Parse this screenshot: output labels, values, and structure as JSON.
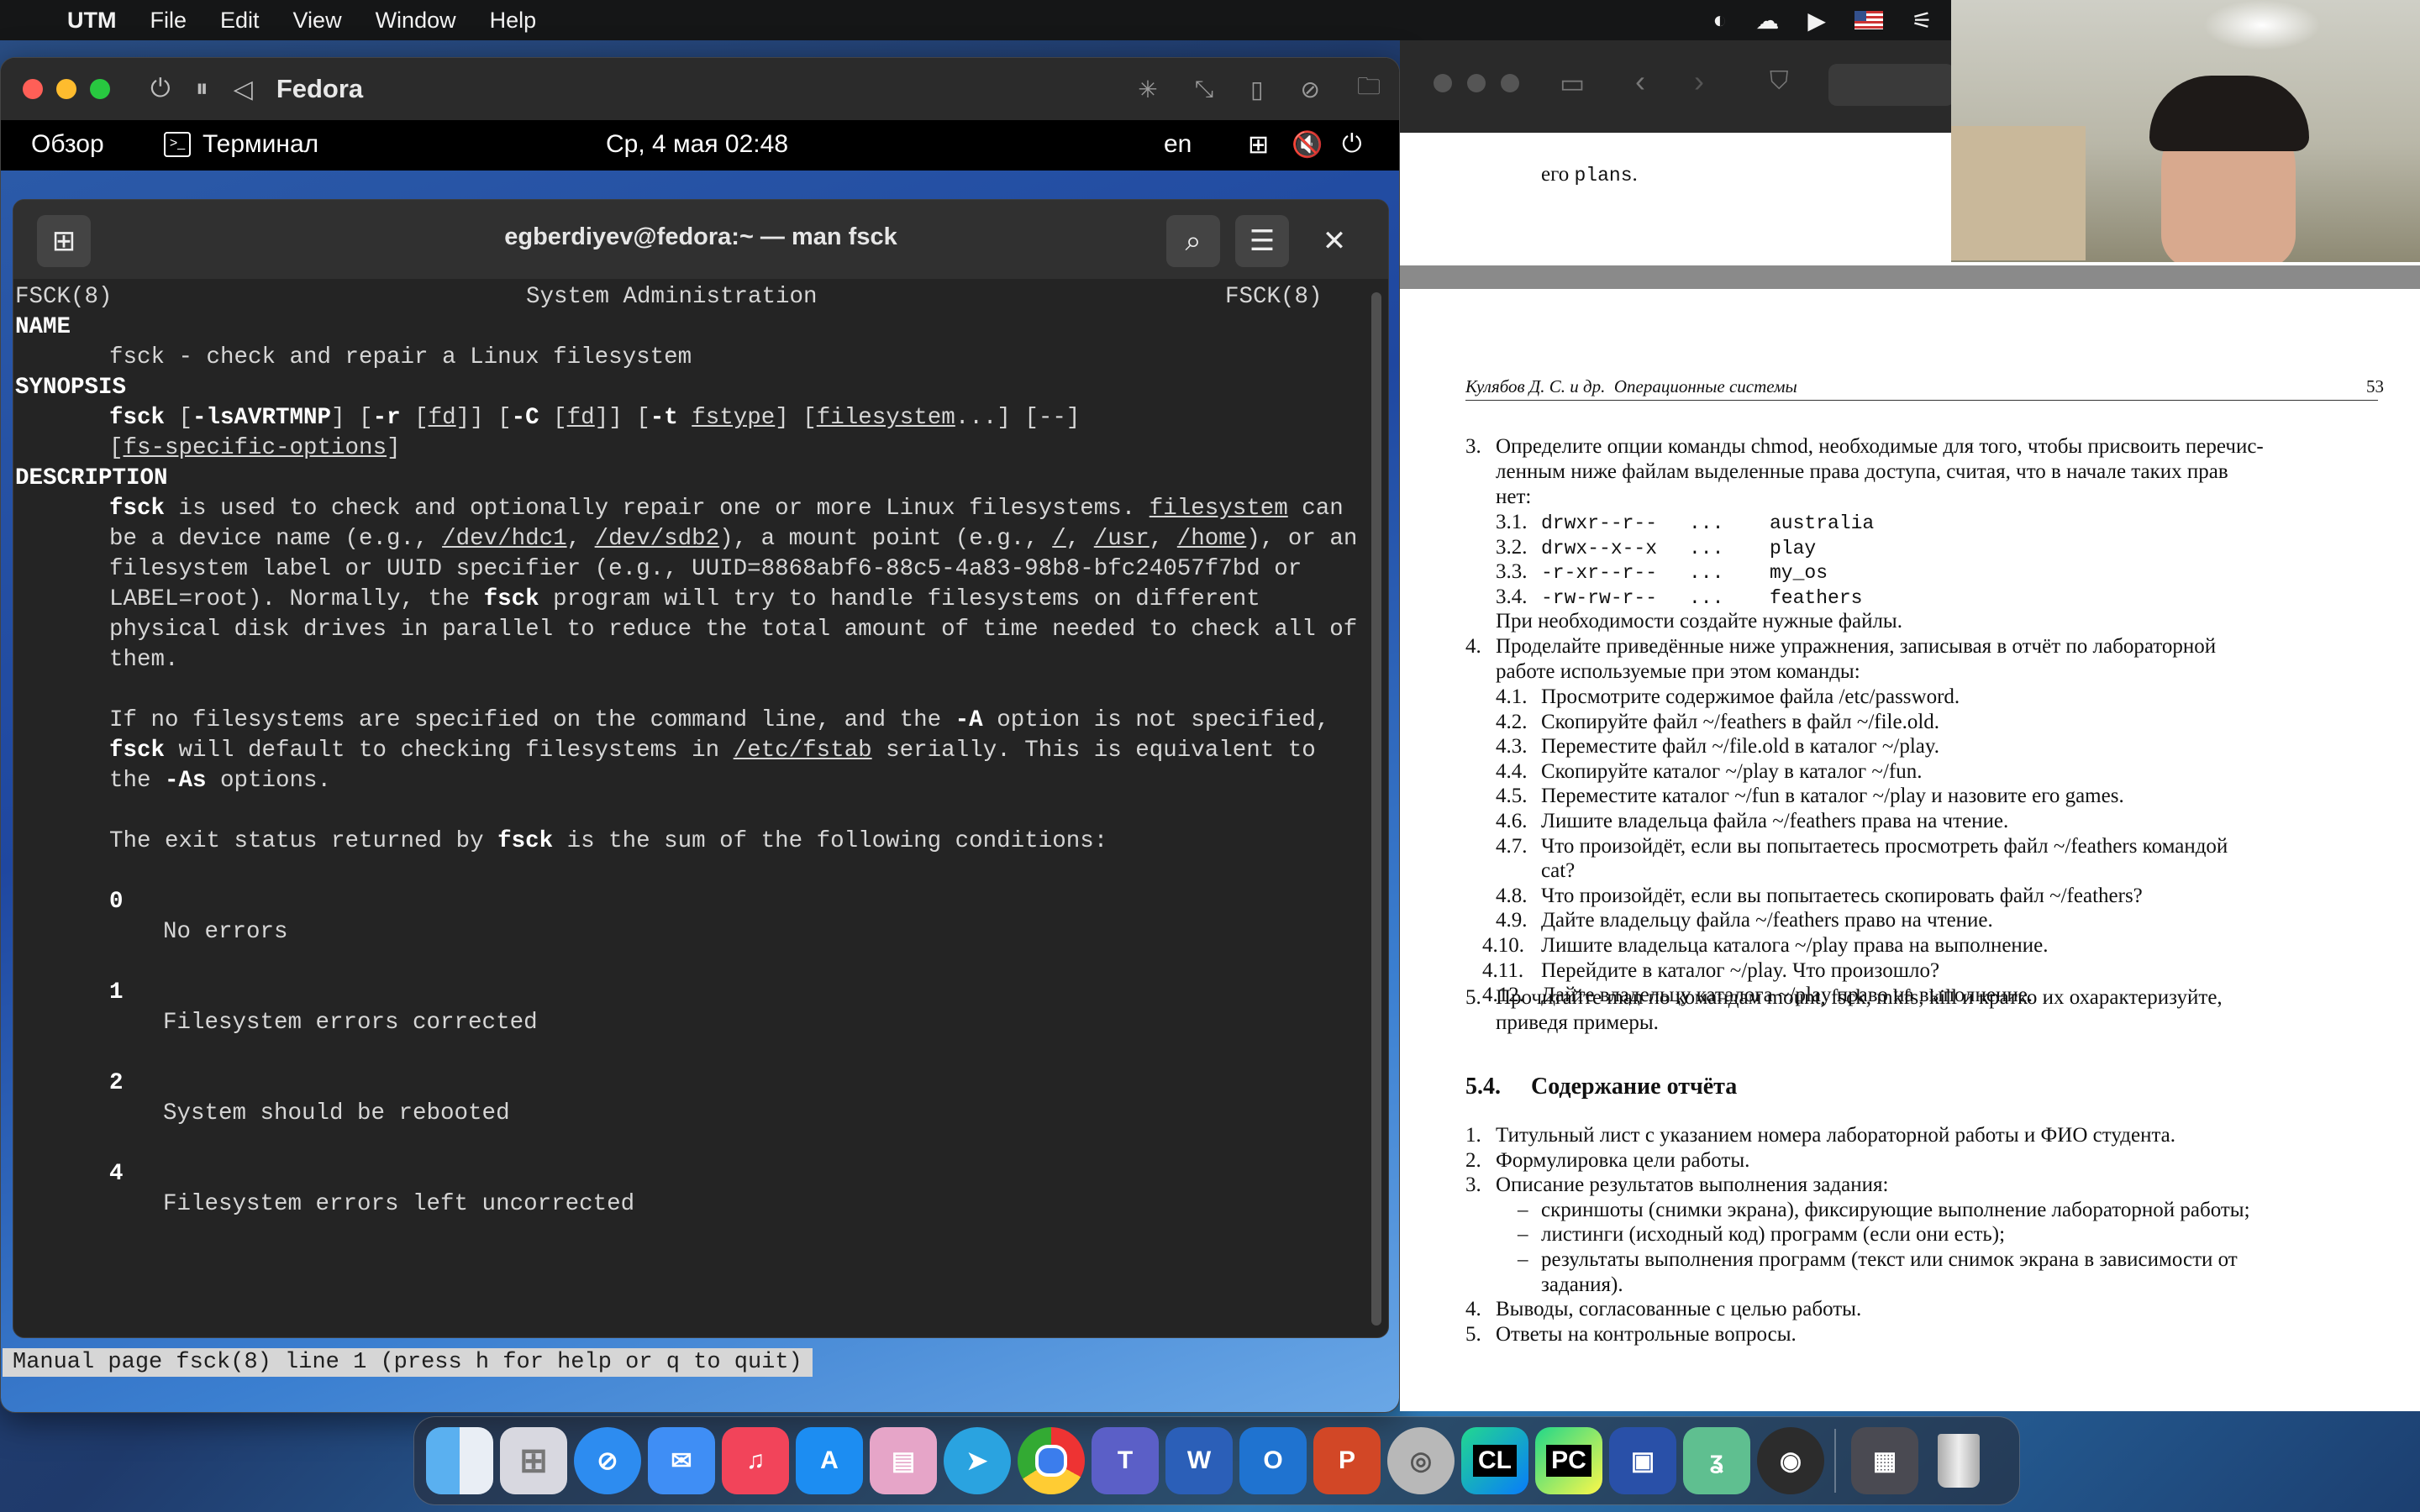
{
  "menubar": {
    "app": "UTM",
    "items": [
      "File",
      "Edit",
      "View",
      "Window",
      "Help"
    ]
  },
  "utm": {
    "vm_name": "Fedora"
  },
  "gnome": {
    "overview": "Обзор",
    "terminal_app": "Терминал",
    "clock": "Ср, 4 мая  02:48",
    "lang": "en"
  },
  "terminal": {
    "title": "egberdiyev@fedora:~ — man fsck",
    "status": "Manual page fsck(8) line 1 (press h for help or q to quit)",
    "header_left": "FSCK(8)",
    "header_center": "System Administration",
    "header_right": "FSCK(8)",
    "name_heading": "NAME",
    "name_line": "fsck - check and repair a Linux filesystem",
    "synopsis_heading": "SYNOPSIS",
    "syn": {
      "fsck": "fsck",
      "s1": " [",
      "opts": "-lsAVRTMNP",
      "s2": "] [",
      "r": "-r",
      "s3": " [",
      "fd": "fd",
      "s4": "]] [",
      "C": "-C",
      "s5": " [",
      "fd2": "fd",
      "s6": "]] [",
      "t": "-t",
      "s7": " ",
      "fstype": "fstype",
      "s8": "] [",
      "filesystem": "filesystem",
      "s9": "...] [--]",
      "l2a": "[",
      "fsopts": "fs-specific-options",
      "l2b": "]"
    },
    "description_heading": "DESCRIPTION",
    "d1": {
      "fsck": "fsck",
      "a": " is used to check and optionally repair one or more Linux filesystems. ",
      "filesystem": "filesystem",
      "b": " can"
    },
    "d2": {
      "a": "be a device name (e.g., ",
      "hdc1": "/dev/hdc1",
      "b": ", ",
      "sdb2": "/dev/sdb2",
      "c": "), a mount point (e.g., ",
      "root": "/",
      "d": ", ",
      "usr": "/usr",
      "e": ", ",
      "home": "/home",
      "f": "), or an"
    },
    "d3": "filesystem label or UUID specifier (e.g., UUID=8868abf6-88c5-4a83-98b8-bfc24057f7bd or",
    "d4": {
      "a": "LABEL=root). Normally, the ",
      "fsck": "fsck",
      "b": " program will try to handle filesystems on different"
    },
    "d5": "physical disk drives in parallel to reduce the total amount of time needed to check all of",
    "d6": "them.",
    "p2a": {
      "a": "If no filesystems are specified on the command line, and the ",
      "A": "-A",
      "b": " option is not specified,"
    },
    "p2b": {
      "fsck": "fsck",
      "a": " will default to checking filesystems in ",
      "fstab": "/etc/fstab",
      "b": " serially. This is equivalent to"
    },
    "p2c": {
      "a": "the ",
      "As": "-As",
      "b": " options."
    },
    "p3": {
      "a": "The exit status returned by ",
      "fsck": "fsck",
      "b": " is the sum of the following conditions:"
    },
    "codes": [
      {
        "code": "0",
        "text": "No errors"
      },
      {
        "code": "1",
        "text": "Filesystem errors corrected"
      },
      {
        "code": "2",
        "text": "System should be rebooted"
      },
      {
        "code": "4",
        "text": "Filesystem errors left uncorrected"
      }
    ]
  },
  "pdf": {
    "top_fragment_a": "его ",
    "top_fragment_code": "plans",
    "top_fragment_b": ".",
    "running_head": "Кулябов Д. С. и др.  Операционные системы",
    "page_num": "53",
    "item3_num": "3.",
    "item3_l1": "Определите опции команды chmod, необходимые для того, чтобы присвоить перечис-",
    "item3_l2": "ленным ниже файлам выделенные права доступа, считая, что в начале таких прав",
    "item3_l3": "нет:",
    "perms": [
      {
        "n": "3.1.",
        "perm": "drwxr--r--",
        "dots": "...",
        "name": "australia"
      },
      {
        "n": "3.2.",
        "perm": "drwx--x--x",
        "dots": "...",
        "name": "play"
      },
      {
        "n": "3.3.",
        "perm": "-r-xr--r--",
        "dots": "...",
        "name": "my_os"
      },
      {
        "n": "3.4.",
        "perm": "-rw-rw-r--",
        "dots": "...",
        "name": "feathers"
      }
    ],
    "create_files": "При необходимости создайте нужные файлы.",
    "item4_num": "4.",
    "item4_l1": "Проделайте приведённые ниже упражнения, записывая в отчёт по лабораторной",
    "item4_l2": "работе используемые при этом команды:",
    "ex": [
      {
        "n": "4.1.",
        "t": "Просмотрите содержимое файла /etc/password."
      },
      {
        "n": "4.2.",
        "t": "Скопируйте файл ~/feathers в файл ~/file.old."
      },
      {
        "n": "4.3.",
        "t": "Переместите файл ~/file.old в каталог ~/play."
      },
      {
        "n": "4.4.",
        "t": "Скопируйте каталог ~/play в каталог ~/fun."
      },
      {
        "n": "4.5.",
        "t": "Переместите каталог ~/fun в каталог ~/play и назовите его games."
      },
      {
        "n": "4.6.",
        "t": "Лишите владельца файла ~/feathers права на чтение."
      },
      {
        "n": "4.7.",
        "t": "Что произойдёт, если вы попытаетесь просмотреть файл ~/feathers командой"
      },
      {
        "n": "",
        "t": "cat?"
      },
      {
        "n": "4.8.",
        "t": "Что произойдёт, если вы попытаетесь скопировать файл ~/feathers?"
      },
      {
        "n": "4.9.",
        "t": "Дайте владельцу файла ~/feathers право на чтение."
      },
      {
        "n": "4.10.",
        "t": "Лишите владельца каталога ~/play права на выполнение."
      },
      {
        "n": "4.11.",
        "t": "Перейдите в каталог ~/play. Что произошло?"
      },
      {
        "n": "4.12.",
        "t": "Дайте владельцу каталога ~/play право на выполнение."
      }
    ],
    "item5_num": "5.",
    "item5_l1": "Прочитайте man по командам mount, fsck, mkfs, kill и кратко их охарактеризуйте,",
    "item5_l2": "приведя примеры.",
    "section_num": "5.4.",
    "section_title": "Содержание отчёта",
    "report": [
      {
        "n": "1.",
        "t": "Титульный лист с указанием номера лабораторной работы и ФИО студента."
      },
      {
        "n": "2.",
        "t": "Формулировка цели работы."
      },
      {
        "n": "3.",
        "t": "Описание результатов выполнения задания:"
      },
      {
        "n": "–",
        "t": "скриншоты (снимки экрана), фиксирующие выполнение лабораторной работы;"
      },
      {
        "n": "–",
        "t": "листинги (исходный код) программ (если они есть);"
      },
      {
        "n": "–",
        "t": "результаты выполнения программ (текст или снимок экрана в зависимости от"
      },
      {
        "n": "",
        "t": "задания)."
      },
      {
        "n": "4.",
        "t": "Выводы, согласованные с целью работы."
      },
      {
        "n": "5.",
        "t": "Ответы на контрольные вопросы."
      }
    ]
  },
  "dock": {
    "icons": [
      "finder-icon",
      "launchpad-icon",
      "safari-icon",
      "mail-icon",
      "music-icon",
      "app-store-icon",
      "preview-icon",
      "telegram-icon",
      "chrome-icon",
      "teams-icon",
      "word-icon",
      "outlook-icon",
      "powerpoint-icon",
      "disk-utility-icon",
      "clion-icon",
      "pycharm-icon",
      "utm-icon",
      "qbittorrent-icon",
      "obs-icon",
      "screenshots-folder-icon",
      "trash-icon"
    ],
    "clion_label": "CL",
    "pycharm_label": "PC"
  }
}
